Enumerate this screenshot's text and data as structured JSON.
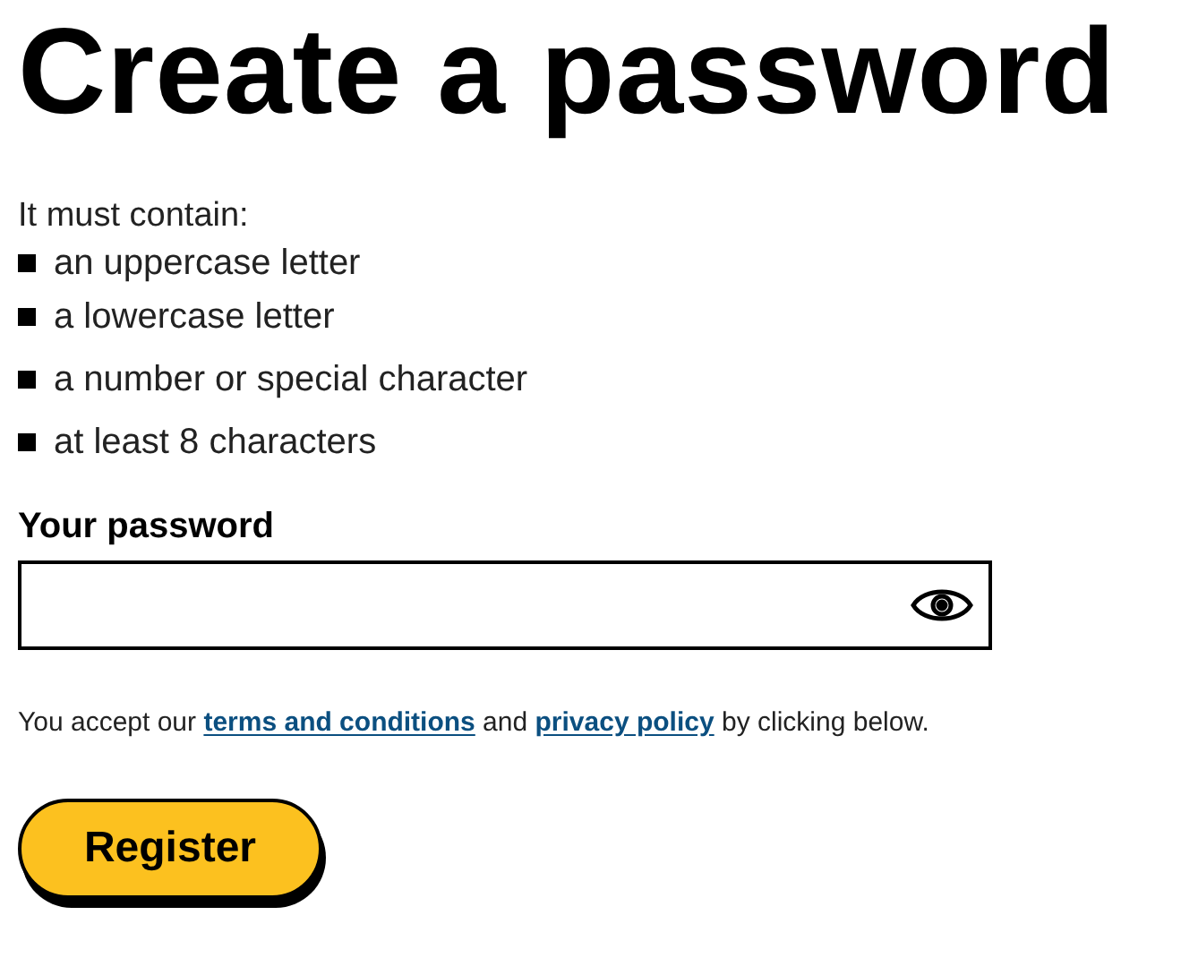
{
  "title": "Create a password",
  "requirements": {
    "intro": "It must contain:",
    "items": [
      "an uppercase letter",
      "a lowercase letter",
      "a number or special character",
      "at least 8 characters"
    ]
  },
  "password_field": {
    "label": "Your password"
  },
  "consent": [
    {
      "kind": "text",
      "text": "You accept our "
    },
    {
      "kind": "link",
      "text": "terms and conditions"
    },
    {
      "kind": "text",
      "text": " and "
    },
    {
      "kind": "link",
      "text": "privacy policy"
    },
    {
      "kind": "text",
      "text": " by clicking below."
    }
  ],
  "buttons": [
    "Register"
  ]
}
